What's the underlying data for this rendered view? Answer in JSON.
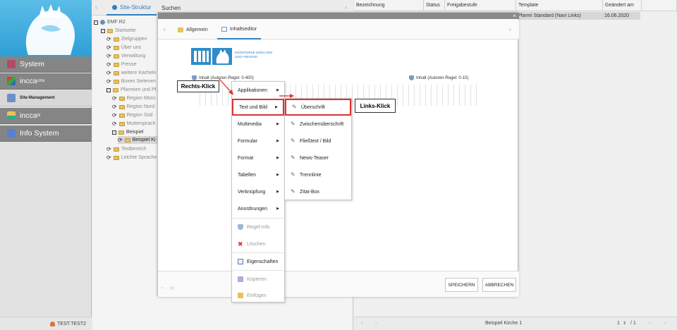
{
  "nav": {
    "items": [
      {
        "label": "System"
      },
      {
        "label": "incca",
        "sup": "cmx"
      },
      {
        "label": "Site-Management"
      },
      {
        "label": "incca",
        "sup": "bi"
      },
      {
        "label": "Info System"
      }
    ],
    "user": "TEST.TEST2"
  },
  "tree": {
    "tabs": [
      "Site-Struktur",
      "Suchen"
    ],
    "items": [
      {
        "label": "EMF R2"
      },
      {
        "label": "Startseite"
      },
      {
        "label": "Zielgruppen"
      },
      {
        "label": "Über uns"
      },
      {
        "label": "Verwaltung"
      },
      {
        "label": "Presse"
      },
      {
        "label": "weitere Kacheln"
      },
      {
        "label": "Boxen Seitenen"
      },
      {
        "label": "Pfarreien und Pf"
      },
      {
        "label": "Region Münc"
      },
      {
        "label": "Region Nord"
      },
      {
        "label": "Region Süd"
      },
      {
        "label": "Muttersprach"
      },
      {
        "label": "Beispiel"
      },
      {
        "label": "Beispiel Ki"
      },
      {
        "label": "Testbereich"
      },
      {
        "label": "Leichte Sprache"
      }
    ]
  },
  "grid": {
    "columns": [
      "Bezeichnung",
      "Status",
      "Freigabestufe",
      "Template",
      "Geändert am"
    ],
    "row": {
      "template": "Pfarrei Standard (Navi Links)",
      "date": "16.06.2020"
    },
    "footer": {
      "title": "Beispiel Kirche 1",
      "page": "1",
      "of": "/ 1"
    }
  },
  "dialog": {
    "tabs": [
      "Allgemein",
      "Inhaltseditor"
    ],
    "logo_text": [
      "ERZDIÖZESE MÜNCHEN",
      "UND FREISING"
    ],
    "content_left": "Inhalt (Autoren-Regel: 0-400)",
    "content_right": "Inhalt (Autoren-Regel: 0-10)",
    "save": "SPEICHERN",
    "cancel": "ABBRECHEN"
  },
  "context_menu": {
    "items": [
      "Applikationen",
      "Text und Bild",
      "Multimedia",
      "Formular",
      "Format",
      "Tabellen",
      "Verknüpfung",
      "Anordnungen",
      "Regel-Info",
      "Löschen",
      "Eigenschaften",
      "Kopieren",
      "Einfügen"
    ]
  },
  "submenu": {
    "items": [
      "Überschrift",
      "Zwischenüberschrift",
      "Fließtext / Bild",
      "News-Teaser",
      "Trennlinie",
      "Zitat-Box"
    ]
  },
  "annotations": {
    "right_click": "Rechts-Klick",
    "left_click": "Links-Klick"
  },
  "colors": {
    "accent": "#2d7fc1",
    "highlight": "#dd3333",
    "nav_dark": "#858585"
  }
}
